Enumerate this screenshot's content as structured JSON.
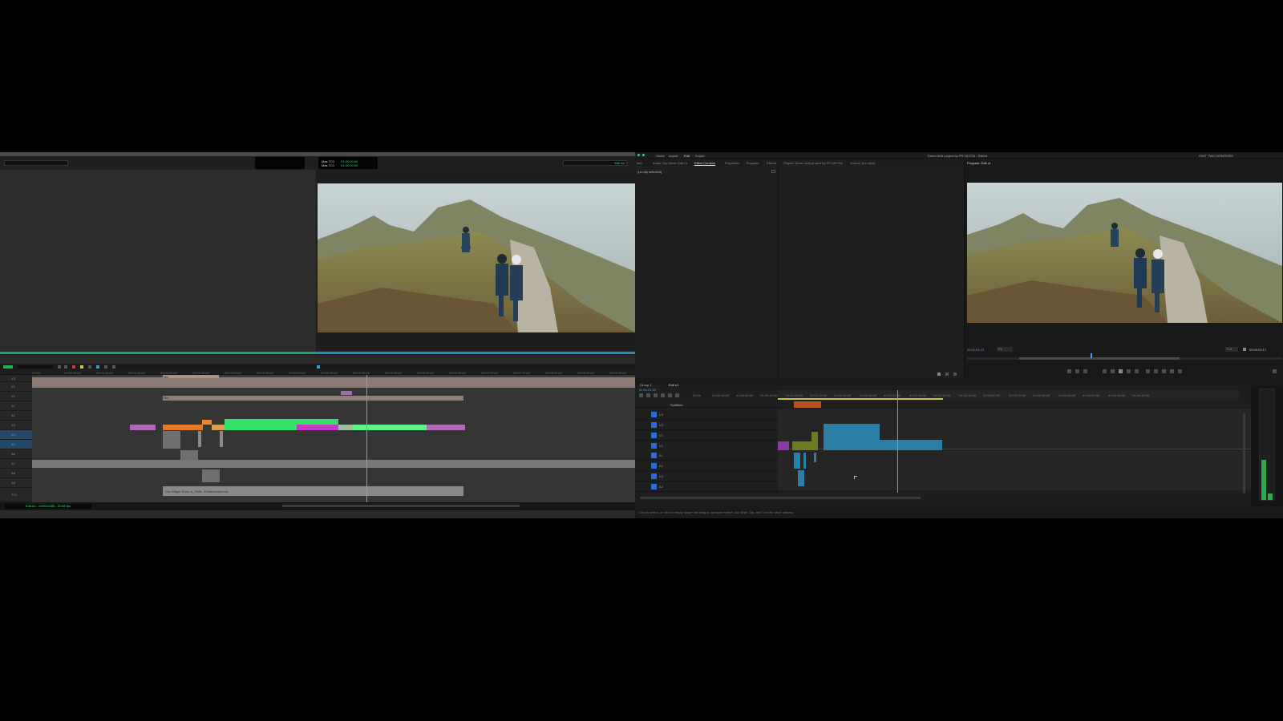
{
  "avid": {
    "timecode": {
      "row1_label": "Mas TC1",
      "row1_value": "01:00:00:00",
      "row2_label": "Mas TC1",
      "row2_value": "01:00:00:00"
    },
    "record_dropdown": "Edit A1",
    "timeline_ruler": [
      "00:00",
      "00:00:30:00",
      "00:01:00:00",
      "00:01:30:00",
      "00:02:00:00",
      "00:02:30:00",
      "00:03:00:00",
      "00:03:30:00",
      "00:04:00:00",
      "00:04:30:00",
      "00:05:00:00",
      "00:05:30:00",
      "00:06:00:00",
      "00:06:30:00",
      "00:07:00:00",
      "00:07:30:00",
      "00:08:00:00",
      "00:08:30:00",
      "00:09:00:00"
    ],
    "track_labels": [
      "V3",
      "V2",
      "V1",
      "A1",
      "A2",
      "A3",
      "A4",
      "A5",
      "A6",
      "A7",
      "A8",
      "A9",
      "TC1"
    ],
    "clip_labels": {
      "title_a": "Title",
      "title_b": "Title",
      "audio_clip": "Gun Magic Rotor-A_0008 - Entrance/sound1"
    },
    "bottom_status": "Edit A1 - 1920x1080 - 23.98 fps"
  },
  "premiere": {
    "menu": [
      "Home",
      "Import",
      "Edit",
      "Export"
    ],
    "window_title": "Demo Avid project by PR 08172A - Edited",
    "workspace_label": "OMIT TWO MONITORS",
    "panel_tabs": [
      "Info",
      "Audio Clip Mixer: Edit v1",
      "Effect Controls",
      "Properties",
      "Program",
      "Effects",
      "Project: Demo Avid project by PR 08172A",
      "Source: (no clips)"
    ],
    "effect_controls_msg": "(no clip selected)",
    "program_tab": "Program: Edit v1",
    "program_timecode": "01:01:01:19",
    "program_fit": "Fit",
    "program_quality": "Full",
    "program_duration": "00:04:04:17",
    "sequence_tabs": [
      "Group 1",
      "Edit v1"
    ],
    "sequence_timecode": "01:01:01:19",
    "ruler_labels": [
      "00:00",
      "01:00:15:00",
      "01:00:30:00",
      "01:00:45:00",
      "01:01:00:00",
      "01:01:15:00",
      "01:01:30:00",
      "01:01:45:00",
      "01:02:00:00",
      "01:02:15:00",
      "01:02:30:00",
      "01:02:45:00",
      "01:03:00:00",
      "01:03:15:00",
      "01:03:30:00",
      "01:03:45:00",
      "01:04:00:00",
      "01:04:15:00",
      "01:04:30:00"
    ],
    "subtitle_track_label": "Subtitles",
    "video_tracks": [
      "V4",
      "V3",
      "V2",
      "V1"
    ],
    "audio_tracks": [
      "A1",
      "A2",
      "A3",
      "A4"
    ],
    "status_bar": "Click to select, or click in empty space and drag to marquee select. Use Shift, Opt, and Cmd for other options."
  },
  "colors": {
    "avid_bg": "#2a2a2a",
    "avid_green": "#18a86a",
    "avid_blue": "#1d8fc2",
    "premiere_blue": "#2a6fd0",
    "clip_teal": "#2b7fa6",
    "clip_magenta": "#c63bc6",
    "clip_green": "#37e06a",
    "clip_orange": "#e07b2a"
  }
}
